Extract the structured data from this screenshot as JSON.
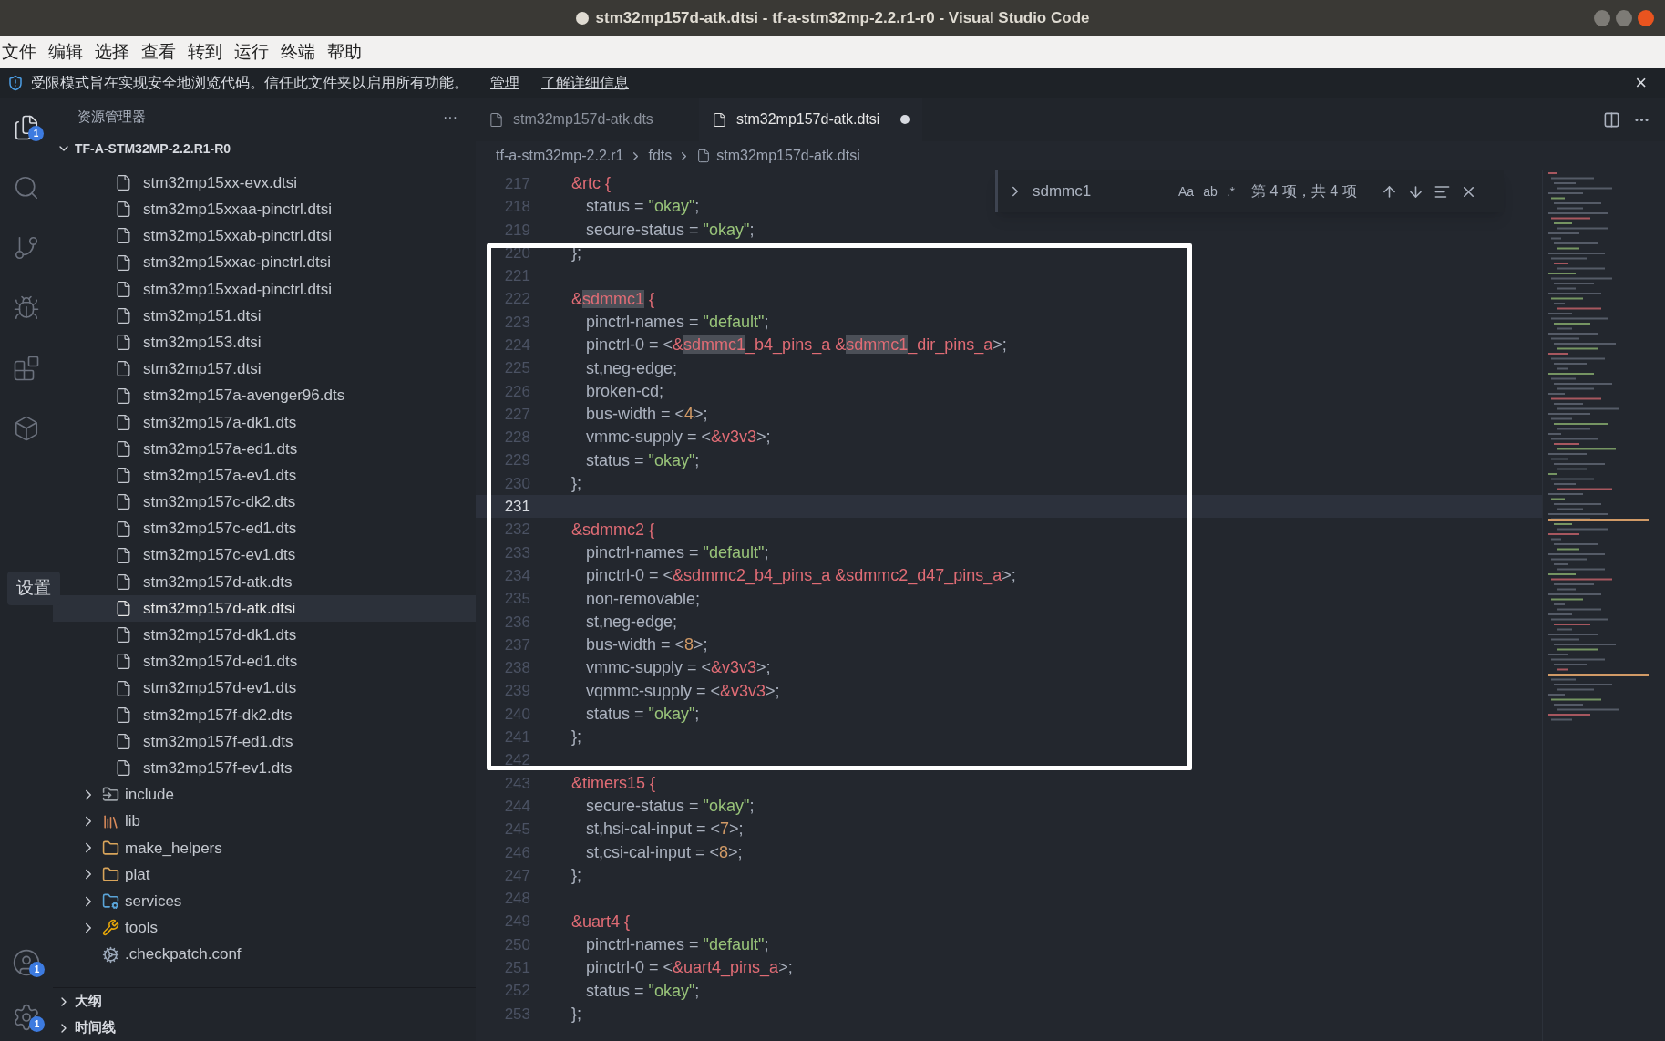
{
  "window": {
    "title": "stm32mp157d-atk.dtsi - tf-a-stm32mp-2.2.r1-r0 - Visual Studio Code",
    "dirty": true
  },
  "menu": [
    "文件",
    "编辑",
    "选择",
    "查看",
    "转到",
    "运行",
    "终端",
    "帮助"
  ],
  "banner": {
    "text": "受限模式旨在实现安全地浏览代码。信任此文件夹以启用所有功能。",
    "links": [
      "管理",
      "了解详细信息"
    ],
    "close": "×"
  },
  "activity_bar": {
    "items": [
      {
        "kind": "files",
        "badge": "1",
        "selected": true
      },
      {
        "kind": "search",
        "selected": false
      },
      {
        "kind": "git",
        "selected": false
      },
      {
        "kind": "debug",
        "selected": false
      },
      {
        "kind": "extensions",
        "selected": false
      },
      {
        "kind": "remote",
        "selected": false
      }
    ],
    "tooltip": "设置",
    "bottom": [
      {
        "kind": "account",
        "badge": "1"
      },
      {
        "kind": "settings",
        "badge": "1"
      }
    ]
  },
  "sidebar": {
    "title": "资源管理器",
    "more": "···",
    "root": "TF-A-STM32MP-2.2.R1-R0",
    "items": [
      {
        "kind": "file",
        "name": "stm32mp15xx-evx.dtsi",
        "selected": false
      },
      {
        "kind": "file",
        "name": "stm32mp15xxaa-pinctrl.dtsi",
        "selected": false
      },
      {
        "kind": "file",
        "name": "stm32mp15xxab-pinctrl.dtsi",
        "selected": false
      },
      {
        "kind": "file",
        "name": "stm32mp15xxac-pinctrl.dtsi",
        "selected": false
      },
      {
        "kind": "file",
        "name": "stm32mp15xxad-pinctrl.dtsi",
        "selected": false
      },
      {
        "kind": "file",
        "name": "stm32mp151.dtsi",
        "selected": false
      },
      {
        "kind": "file",
        "name": "stm32mp153.dtsi",
        "selected": false
      },
      {
        "kind": "file",
        "name": "stm32mp157.dtsi",
        "selected": false
      },
      {
        "kind": "file",
        "name": "stm32mp157a-avenger96.dts",
        "selected": false
      },
      {
        "kind": "file",
        "name": "stm32mp157a-dk1.dts",
        "selected": false
      },
      {
        "kind": "file",
        "name": "stm32mp157a-ed1.dts",
        "selected": false
      },
      {
        "kind": "file",
        "name": "stm32mp157a-ev1.dts",
        "selected": false
      },
      {
        "kind": "file",
        "name": "stm32mp157c-dk2.dts",
        "selected": false
      },
      {
        "kind": "file",
        "name": "stm32mp157c-ed1.dts",
        "selected": false
      },
      {
        "kind": "file",
        "name": "stm32mp157c-ev1.dts",
        "selected": false
      },
      {
        "kind": "file",
        "name": "stm32mp157d-atk.dts",
        "selected": false
      },
      {
        "kind": "file",
        "name": "stm32mp157d-atk.dtsi",
        "selected": true
      },
      {
        "kind": "file",
        "name": "stm32mp157d-dk1.dts",
        "selected": false
      },
      {
        "kind": "file",
        "name": "stm32mp157d-ed1.dts",
        "selected": false
      },
      {
        "kind": "file",
        "name": "stm32mp157d-ev1.dts",
        "selected": false
      },
      {
        "kind": "file",
        "name": "stm32mp157f-dk2.dts",
        "selected": false
      },
      {
        "kind": "file",
        "name": "stm32mp157f-ed1.dts",
        "selected": false
      },
      {
        "kind": "file",
        "name": "stm32mp157f-ev1.dts",
        "selected": false
      },
      {
        "kind": "include",
        "name": "include",
        "expanded": false
      },
      {
        "kind": "library",
        "name": "lib",
        "expanded": false
      },
      {
        "kind": "folder",
        "name": "make_helpers",
        "expanded": false
      },
      {
        "kind": "folder",
        "name": "plat",
        "expanded": false
      },
      {
        "kind": "services",
        "name": "services",
        "expanded": false
      },
      {
        "kind": "tools",
        "name": "tools",
        "expanded": false
      },
      {
        "kind": "config",
        "name": ".checkpatch.conf",
        "selected": false
      }
    ],
    "sections": [
      {
        "label": "大纲",
        "expanded": false
      },
      {
        "label": "时间线",
        "expanded": false
      }
    ]
  },
  "tabs": [
    {
      "label": "stm32mp157d-atk.dts",
      "selected": false,
      "dirty": false
    },
    {
      "label": "stm32mp157d-atk.dtsi",
      "selected": true,
      "dirty": true
    }
  ],
  "breadcrumb": [
    "tf-a-stm32mp-2.2.r1",
    "fdts",
    "stm32mp157d-atk.dtsi"
  ],
  "find": {
    "value": "sdmmc1",
    "options": [
      "Aa",
      "ab",
      ".*"
    ],
    "result": "第 4 项，共 4 项"
  },
  "code_blocks": [
    {
      "framed": false,
      "lines": [
        {
          "n": "217",
          "current": false,
          "indent": false,
          "tokens": [
            {
              "text": "&rtc {",
              "kind": "ref"
            }
          ]
        },
        {
          "n": "218",
          "current": false,
          "indent": true,
          "tokens": [
            {
              "text": "status = ",
              "kind": "plain"
            },
            {
              "text": "\"okay\"",
              "kind": "string"
            },
            {
              "text": ";",
              "kind": "plain"
            }
          ]
        },
        {
          "n": "219",
          "current": false,
          "indent": true,
          "tokens": [
            {
              "text": "secure-status = ",
              "kind": "plain"
            },
            {
              "text": "\"okay\"",
              "kind": "string"
            },
            {
              "text": ";",
              "kind": "plain"
            }
          ]
        }
      ]
    },
    {
      "framed": true,
      "lines": [
        {
          "n": "220",
          "current": false,
          "indent": false,
          "tokens": [
            {
              "text": "};",
              "kind": "plain"
            }
          ]
        },
        {
          "n": "221",
          "current": false
        },
        {
          "n": "222",
          "current": false,
          "indent": false,
          "tokens": [
            {
              "text": "&",
              "kind": "ref"
            },
            {
              "text": "sdmmc1",
              "kind": "match"
            },
            {
              "text": " {",
              "kind": "ref"
            }
          ]
        },
        {
          "n": "223",
          "current": false,
          "indent": true,
          "tokens": [
            {
              "text": "pinctrl-names = ",
              "kind": "plain"
            },
            {
              "text": "\"default\"",
              "kind": "string"
            },
            {
              "text": ";",
              "kind": "plain"
            }
          ]
        },
        {
          "n": "224",
          "current": false,
          "indent": true,
          "tokens": [
            {
              "text": "pinctrl-0 = <",
              "kind": "plain"
            },
            {
              "text": "&",
              "kind": "ref"
            },
            {
              "text": "sdmmc1",
              "kind": "match"
            },
            {
              "text": "_b4_pins_a &",
              "kind": "ref"
            },
            {
              "text": "sdmmc1",
              "kind": "match"
            },
            {
              "text": "_dir_pins_a",
              "kind": "ref"
            },
            {
              "text": ">;",
              "kind": "plain"
            }
          ]
        },
        {
          "n": "225",
          "current": false,
          "indent": true,
          "tokens": [
            {
              "text": "st,neg-edge;",
              "kind": "plain"
            }
          ]
        },
        {
          "n": "226",
          "current": false,
          "indent": true,
          "tokens": [
            {
              "text": "broken-cd;",
              "kind": "plain"
            }
          ]
        },
        {
          "n": "227",
          "current": false,
          "indent": true,
          "tokens": [
            {
              "text": "bus-width = <",
              "kind": "plain"
            },
            {
              "text": "4",
              "kind": "number"
            },
            {
              "text": ">;",
              "kind": "plain"
            }
          ]
        },
        {
          "n": "228",
          "current": false,
          "indent": true,
          "tokens": [
            {
              "text": "vmmc-supply = <",
              "kind": "plain"
            },
            {
              "text": "&v3v3",
              "kind": "ref"
            },
            {
              "text": ">;",
              "kind": "plain"
            }
          ]
        },
        {
          "n": "229",
          "current": false,
          "indent": true,
          "tokens": [
            {
              "text": "status = ",
              "kind": "plain"
            },
            {
              "text": "\"okay\"",
              "kind": "string"
            },
            {
              "text": ";",
              "kind": "plain"
            }
          ]
        },
        {
          "n": "230",
          "current": false,
          "indent": false,
          "tokens": [
            {
              "text": "};",
              "kind": "plain"
            }
          ]
        },
        {
          "n": "231",
          "current": true
        },
        {
          "n": "232",
          "current": false,
          "indent": false,
          "tokens": [
            {
              "text": "&sdmmc2 {",
              "kind": "ref"
            }
          ]
        },
        {
          "n": "233",
          "current": false,
          "indent": true,
          "tokens": [
            {
              "text": "pinctrl-names = ",
              "kind": "plain"
            },
            {
              "text": "\"default\"",
              "kind": "string"
            },
            {
              "text": ";",
              "kind": "plain"
            }
          ]
        },
        {
          "n": "234",
          "current": false,
          "indent": true,
          "tokens": [
            {
              "text": "pinctrl-0 = <",
              "kind": "plain"
            },
            {
              "text": "&sdmmc2_b4_pins_a &sdmmc2_d47_pins_a",
              "kind": "ref"
            },
            {
              "text": ">;",
              "kind": "plain"
            }
          ]
        },
        {
          "n": "235",
          "current": false,
          "indent": true,
          "tokens": [
            {
              "text": "non-removable;",
              "kind": "plain"
            }
          ]
        },
        {
          "n": "236",
          "current": false,
          "indent": true,
          "tokens": [
            {
              "text": "st,neg-edge;",
              "kind": "plain"
            }
          ]
        },
        {
          "n": "237",
          "current": false,
          "indent": true,
          "tokens": [
            {
              "text": "bus-width = <",
              "kind": "plain"
            },
            {
              "text": "8",
              "kind": "number"
            },
            {
              "text": ">;",
              "kind": "plain"
            }
          ]
        },
        {
          "n": "238",
          "current": false,
          "indent": true,
          "tokens": [
            {
              "text": "vmmc-supply = <",
              "kind": "plain"
            },
            {
              "text": "&v3v3",
              "kind": "ref"
            },
            {
              "text": ">;",
              "kind": "plain"
            }
          ]
        },
        {
          "n": "239",
          "current": false,
          "indent": true,
          "tokens": [
            {
              "text": "vqmmc-supply = <",
              "kind": "plain"
            },
            {
              "text": "&v3v3",
              "kind": "ref"
            },
            {
              "text": ">;",
              "kind": "plain"
            }
          ]
        },
        {
          "n": "240",
          "current": false,
          "indent": true,
          "tokens": [
            {
              "text": "status = ",
              "kind": "plain"
            },
            {
              "text": "\"okay\"",
              "kind": "string"
            },
            {
              "text": ";",
              "kind": "plain"
            }
          ]
        },
        {
          "n": "241",
          "current": false,
          "indent": false,
          "tokens": [
            {
              "text": "};",
              "kind": "plain"
            }
          ]
        },
        {
          "n": "242",
          "current": false
        }
      ]
    },
    {
      "framed": false,
      "lines": [
        {
          "n": "243",
          "current": false,
          "indent": false,
          "tokens": [
            {
              "text": "&timers15 {",
              "kind": "ref"
            }
          ]
        },
        {
          "n": "244",
          "current": false,
          "indent": true,
          "tokens": [
            {
              "text": "secure-status = ",
              "kind": "plain"
            },
            {
              "text": "\"okay\"",
              "kind": "string"
            },
            {
              "text": ";",
              "kind": "plain"
            }
          ]
        },
        {
          "n": "245",
          "current": false,
          "indent": true,
          "tokens": [
            {
              "text": "st,hsi-cal-input = <",
              "kind": "plain"
            },
            {
              "text": "7",
              "kind": "number"
            },
            {
              "text": ">;",
              "kind": "plain"
            }
          ]
        },
        {
          "n": "246",
          "current": false,
          "indent": true,
          "tokens": [
            {
              "text": "st,csi-cal-input = <",
              "kind": "plain"
            },
            {
              "text": "8",
              "kind": "number"
            },
            {
              "text": ">;",
              "kind": "plain"
            }
          ]
        },
        {
          "n": "247",
          "current": false,
          "indent": false,
          "tokens": [
            {
              "text": "};",
              "kind": "plain"
            }
          ]
        },
        {
          "n": "248",
          "current": false
        },
        {
          "n": "249",
          "current": false,
          "indent": false,
          "tokens": [
            {
              "text": "&uart4 {",
              "kind": "ref"
            }
          ]
        },
        {
          "n": "250",
          "current": false,
          "indent": true,
          "tokens": [
            {
              "text": "pinctrl-names = ",
              "kind": "plain"
            },
            {
              "text": "\"default\"",
              "kind": "string"
            },
            {
              "text": ";",
              "kind": "plain"
            }
          ]
        },
        {
          "n": "251",
          "current": false,
          "indent": true,
          "tokens": [
            {
              "text": "pinctrl-0 = <",
              "kind": "plain"
            },
            {
              "text": "&uart4_pins_a",
              "kind": "ref"
            },
            {
              "text": ">;",
              "kind": "plain"
            }
          ]
        },
        {
          "n": "252",
          "current": false,
          "indent": true,
          "tokens": [
            {
              "text": "status = ",
              "kind": "plain"
            },
            {
              "text": "\"okay\"",
              "kind": "string"
            },
            {
              "text": ";",
              "kind": "plain"
            }
          ]
        },
        {
          "n": "253",
          "current": false,
          "indent": false,
          "tokens": [
            {
              "text": "};",
              "kind": "plain"
            }
          ]
        }
      ]
    }
  ]
}
